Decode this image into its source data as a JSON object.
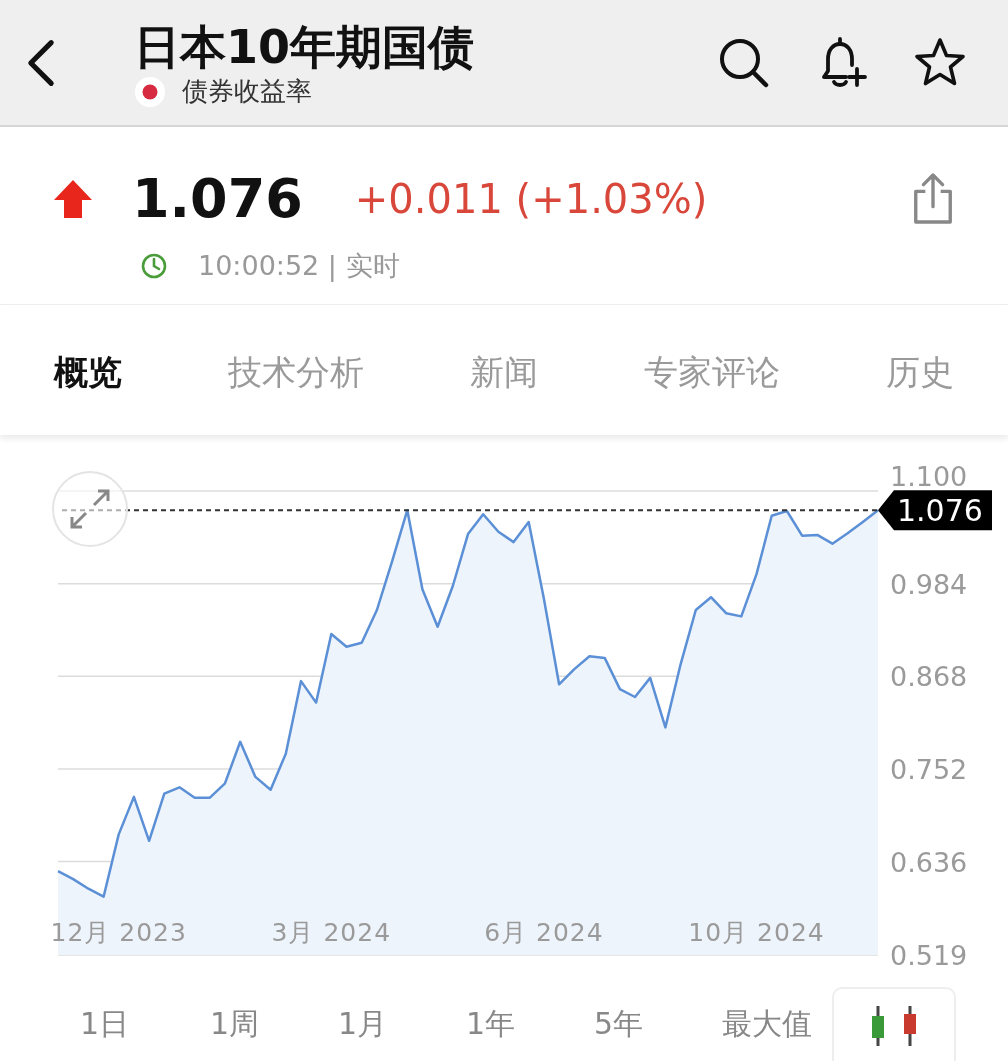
{
  "header": {
    "title": "日本10年期国债",
    "subtitle": "债券收益率"
  },
  "quote": {
    "rising": true,
    "price": "1.076",
    "change": "+0.011 (+1.03%)",
    "time": "10:00:52 | 实时"
  },
  "tabs": [
    {
      "label": "概览",
      "selected": true
    },
    {
      "label": "技术分析",
      "selected": false
    },
    {
      "label": "新闻",
      "selected": false
    },
    {
      "label": "专家评论",
      "selected": false
    },
    {
      "label": "历史",
      "selected": false
    }
  ],
  "chart": {
    "chart_data": {
      "type": "area",
      "categories": [
        null,
        null,
        null,
        null,
        "12月 2023",
        null,
        null,
        null,
        null,
        null,
        null,
        null,
        null,
        null,
        null,
        null,
        null,
        null,
        "3月 2024",
        null,
        null,
        null,
        null,
        null,
        null,
        null,
        null,
        null,
        null,
        null,
        null,
        null,
        "6月 2024",
        null,
        null,
        null,
        null,
        null,
        null,
        null,
        null,
        null,
        null,
        null,
        null,
        null,
        "10月 2024",
        null,
        null,
        null,
        null,
        null,
        null,
        null,
        null
      ],
      "series": [
        {
          "color": "#5b8fd6",
          "values": [
            0.624,
            0.614,
            0.602,
            0.592,
            0.67,
            0.717,
            0.662,
            0.721,
            0.729,
            0.716,
            0.716,
            0.734,
            0.786,
            0.742,
            0.726,
            0.771,
            0.862,
            0.835,
            0.921,
            0.905,
            0.91,
            0.951,
            1.012,
            1.076,
            0.977,
            0.93,
            0.981,
            1.046,
            1.071,
            1.049,
            1.036,
            1.061,
            0.965,
            0.858,
            0.877,
            0.893,
            0.891,
            0.852,
            0.842,
            0.866,
            0.804,
            0.883,
            0.951,
            0.967,
            0.947,
            0.943,
            0.996,
            1.069,
            1.075,
            1.044,
            1.045,
            1.034,
            1.047,
            1.061,
            1.076
          ]
        }
      ],
      "ylim": [
        0.519,
        1.1
      ],
      "grid": true,
      "ref_lines": [
        {
          "axis": "y",
          "value": 1.076,
          "label": "1.076"
        }
      ],
      "yticks": [
        {
          "value": 0.519,
          "label": "0.519"
        },
        {
          "value": 0.636,
          "label": "0.636"
        },
        {
          "value": 0.752,
          "label": "0.752"
        },
        {
          "value": 0.868,
          "label": "0.868"
        },
        {
          "value": 0.984,
          "label": "0.984"
        },
        {
          "value": 1.1,
          "label": "1.100"
        }
      ]
    }
  },
  "ranges": [
    "1日",
    "1周",
    "1月",
    "1年",
    "5年",
    "最大值"
  ]
}
